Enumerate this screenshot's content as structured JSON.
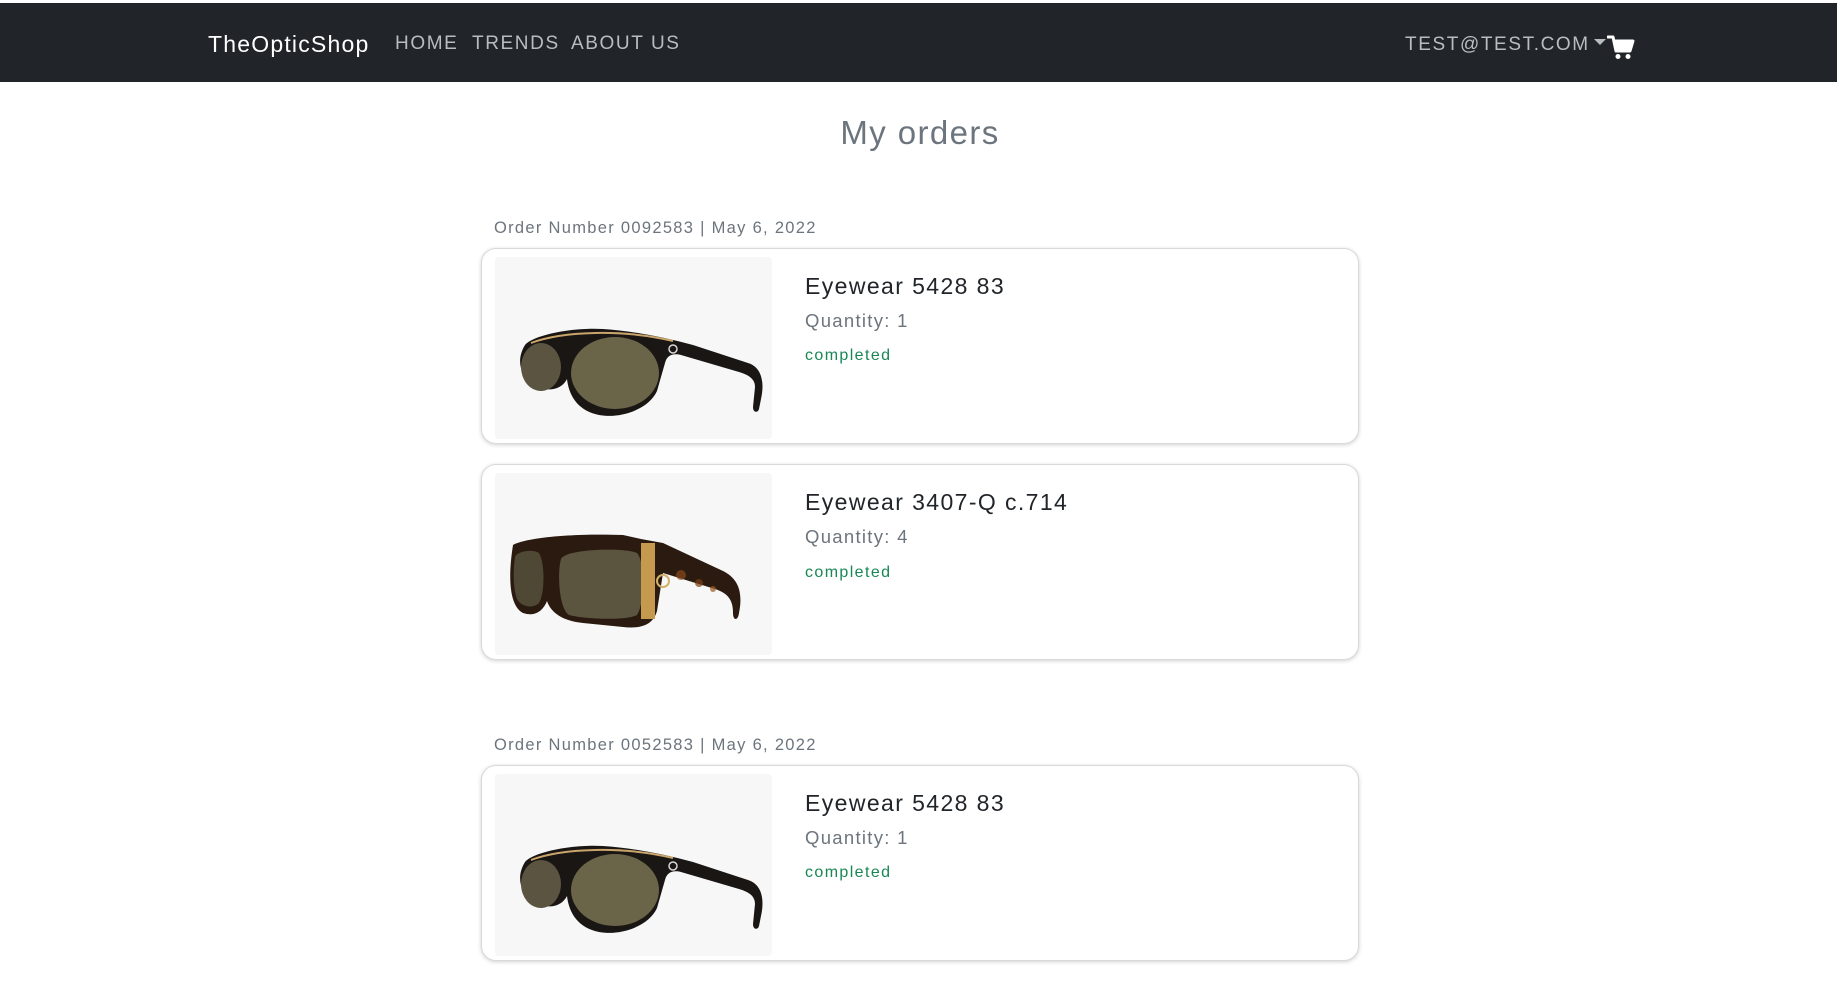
{
  "navbar": {
    "brand": "TheOpticShop",
    "links": [
      "HOME",
      "TRENDS",
      "ABOUT US"
    ],
    "user": "TEST@TEST.COM",
    "cart_icon": "shopping-cart-icon",
    "background": "#212529"
  },
  "page": {
    "title": "My orders"
  },
  "orders": [
    {
      "label": "Order Number 0092583 | May 6, 2022",
      "items": [
        {
          "name": "Eyewear 5428 83",
          "quantity": "Quantity: 1",
          "status": "completed"
        },
        {
          "name": "Eyewear 3407-Q c.714",
          "quantity": "Quantity: 4",
          "status": "completed"
        }
      ]
    },
    {
      "label": "Order Number 0052583 | May 6, 2022",
      "items": [
        {
          "name": "Eyewear 5428 83",
          "quantity": "Quantity: 1",
          "status": "completed"
        }
      ]
    }
  ],
  "colors": {
    "status_completed": "#198754",
    "muted_text": "#6c757d"
  }
}
